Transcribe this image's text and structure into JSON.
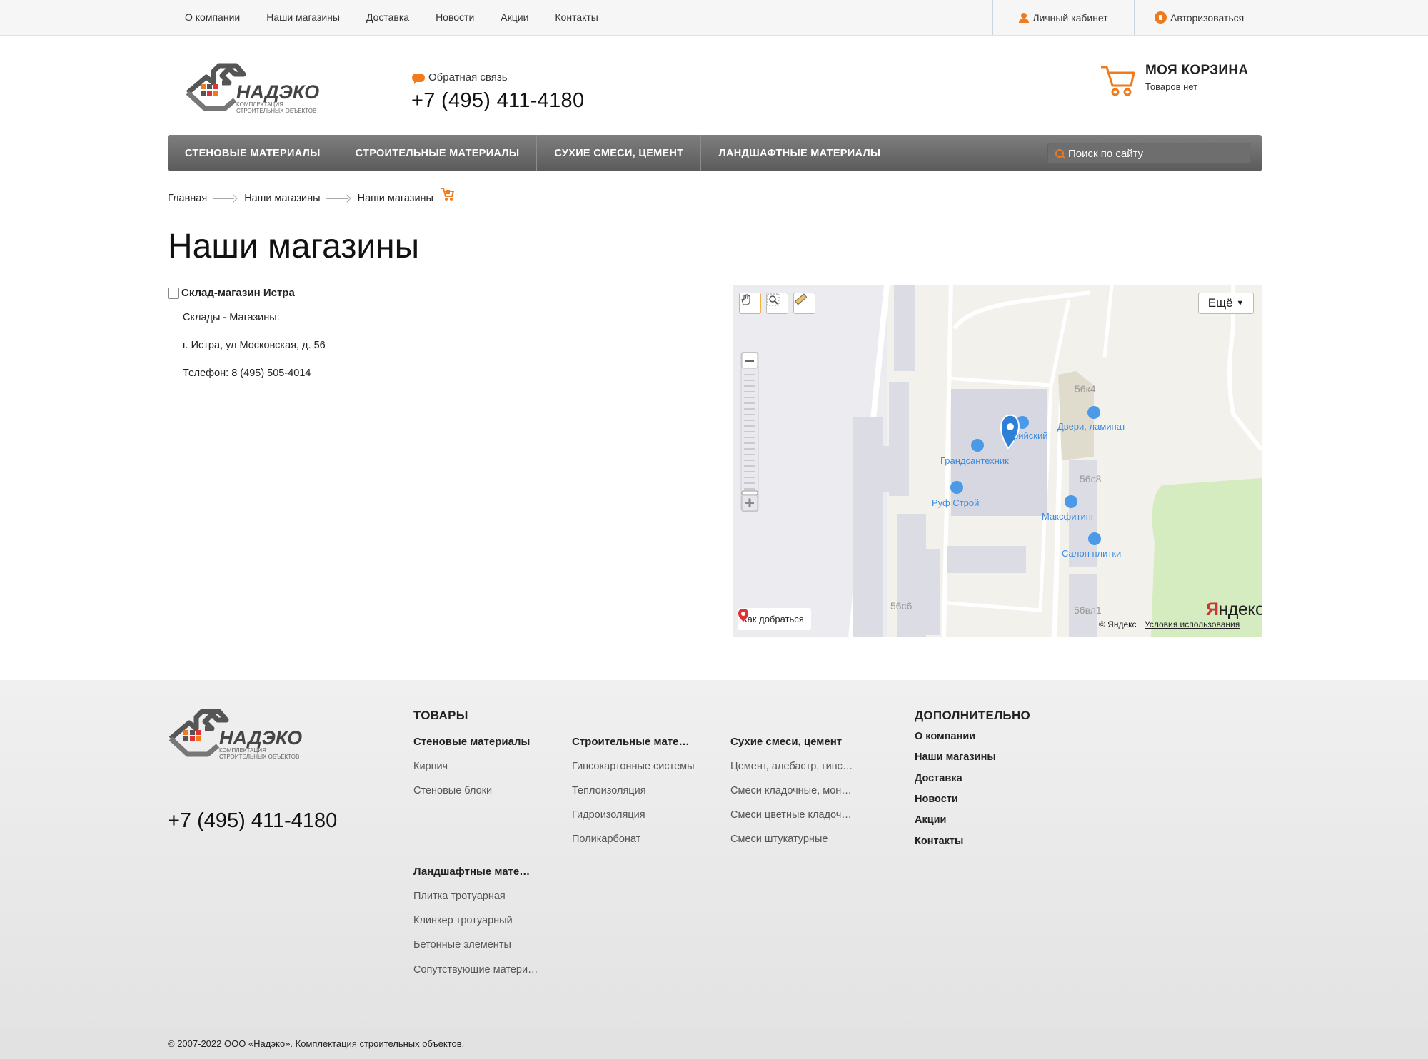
{
  "topnav": [
    "О компании",
    "Наши магазины",
    "Доставка",
    "Новости",
    "Акции",
    "Контакты"
  ],
  "account": {
    "cabinet": "Личный кабинет",
    "login": "Авторизоваться"
  },
  "logo": {
    "name": "НАДЭКО",
    "tagline_1": "КОМПЛЕКТАЦИЯ",
    "tagline_2": "СТРОИТЕЛЬНЫХ ОБЪЕКТОВ"
  },
  "header": {
    "feedback": "Обратная связь",
    "phone": "+7 (495) 411-4180"
  },
  "cart": {
    "title": "МОЯ КОРЗИНА",
    "status": "Товаров нет"
  },
  "mainnav": [
    "СТЕНОВЫЕ МАТЕРИАЛЫ",
    "СТРОИТЕЛЬНЫЕ МАТЕРИАЛЫ",
    "СУХИЕ СМЕСИ, ЦЕМЕНТ",
    "ЛАНДШАФТНЫЕ МАТЕРИАЛЫ"
  ],
  "search": {
    "placeholder": "Поиск по сайту"
  },
  "breadcrumb": [
    "Главная",
    "Наши магазины",
    "Наши магазины"
  ],
  "page_title": "Наши магазины",
  "store": {
    "name": "Склад-магазин Истра",
    "type": "Склады - Магазины:",
    "address": "г. Истра, ул Московская, д. 56",
    "phone": "Телефон: 8 (495) 505-4014"
  },
  "map": {
    "more_button": "Ещё",
    "route_button": "Как добраться",
    "copyright": "© Яндекс",
    "terms": "Условия использования",
    "brand_y": "Я",
    "brand_rest": "ндекс",
    "buildings": [
      "56к4",
      "56с8",
      "56с6",
      "56вл1"
    ],
    "labels": [
      "Двери, ламинат",
      "рийский",
      "Грандсантехник",
      "Руф Строй",
      "Максфитинг",
      "Салон плитки"
    ]
  },
  "footer": {
    "phone": "+7 (495) 411-4180",
    "goods_heading": "ТОВАРЫ",
    "extra_heading": "ДОПОЛНИТЕЛЬНО",
    "categories": [
      {
        "title": "Стеновые материалы",
        "links": [
          "Кирпич",
          "Стеновые блоки"
        ]
      },
      {
        "title": "Строительные мате…",
        "links": [
          "Гипсокартонные системы",
          "Теплоизоляция",
          "Гидроизоляция",
          "Поликарбонат"
        ]
      },
      {
        "title": "Сухие смеси, цемент",
        "links": [
          "Цемент, алебастр, гипс…",
          "Смеси кладочные, мон…",
          "Смеси цветные кладоч…",
          "Смеси штукатурные"
        ]
      },
      {
        "title": "Ландшафтные мате…",
        "links": [
          "Плитка тротуарная",
          "Клинкер тротуарный",
          "Бетонные элементы",
          "Сопутствующие матери…"
        ]
      }
    ],
    "extra_links": [
      "О компании",
      "Наши магазины",
      "Доставка",
      "Новости",
      "Акции",
      "Контакты"
    ],
    "copyright": "© 2007-2022 ООО «Надэко». Комплектация строительных объектов."
  },
  "colors": {
    "accent": "#f07b1d",
    "nav_bg": "#6a6a6a",
    "map_label": "#3c8be0"
  }
}
